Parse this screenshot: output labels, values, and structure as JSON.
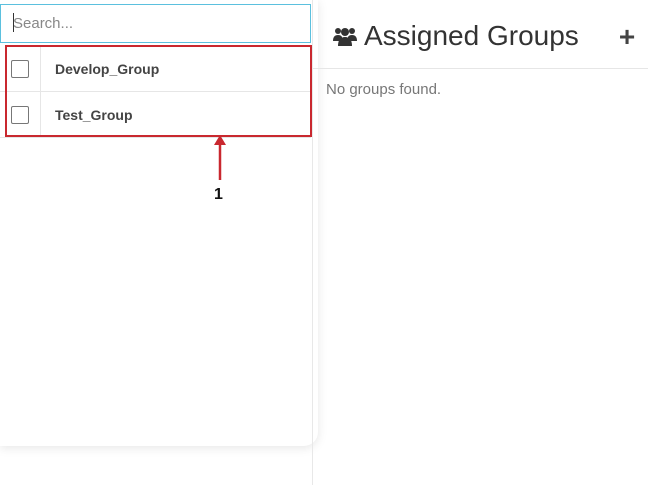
{
  "search": {
    "placeholder": "Search..."
  },
  "groups": [
    {
      "name": "Develop_Group"
    },
    {
      "name": "Test_Group"
    }
  ],
  "annotation": {
    "number": "1",
    "color": "#c9282f"
  },
  "assigned": {
    "title": "Assigned Groups",
    "icon": "users-icon",
    "add_label": "+",
    "empty_message": "No groups found."
  },
  "colors": {
    "accent": "#5bc0de",
    "highlight": "#c9282f"
  }
}
